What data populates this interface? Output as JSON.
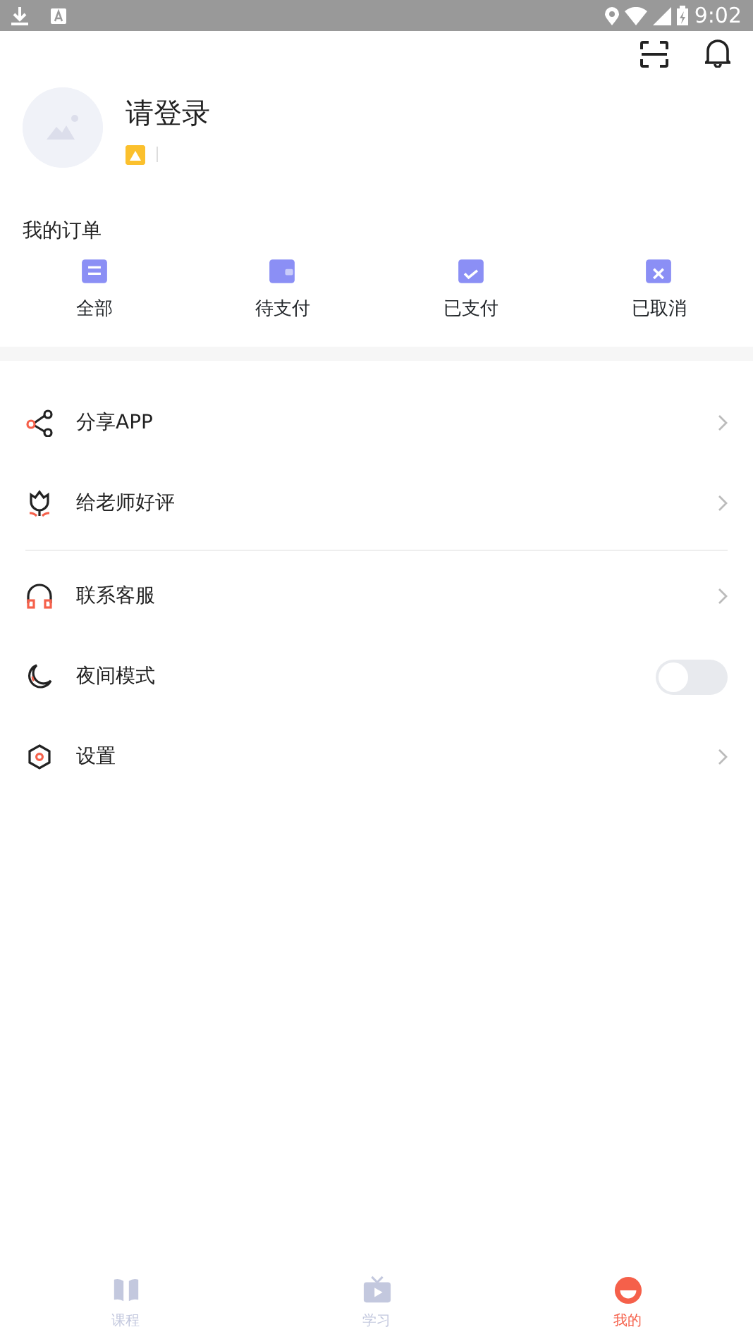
{
  "status_bar": {
    "time": "9:02"
  },
  "profile": {
    "name": "请登录"
  },
  "orders": {
    "title": "我的订单",
    "items": [
      {
        "label": "全部",
        "kind": "all"
      },
      {
        "label": "待支付",
        "kind": "unpaid"
      },
      {
        "label": "已支付",
        "kind": "paid"
      },
      {
        "label": "已取消",
        "kind": "cancelled"
      }
    ]
  },
  "menu_groups": [
    [
      {
        "label": "分享APP",
        "kind": "link"
      },
      {
        "label": "给老师好评",
        "kind": "link"
      }
    ],
    [
      {
        "label": "联系客服",
        "kind": "link"
      },
      {
        "label": "夜间模式",
        "kind": "toggle",
        "on": false
      },
      {
        "label": "设置",
        "kind": "link"
      }
    ]
  ],
  "tabs": [
    {
      "label": "课程",
      "selected": false
    },
    {
      "label": "学习",
      "selected": false
    },
    {
      "label": "我的",
      "selected": true
    }
  ]
}
